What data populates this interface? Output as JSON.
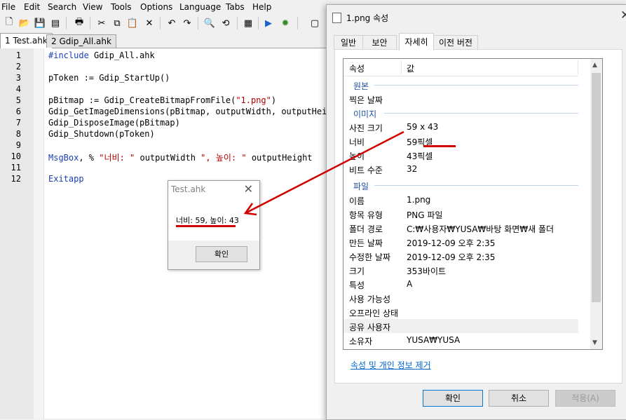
{
  "editor": {
    "menu": [
      "File",
      "Edit",
      "Search",
      "View",
      "Tools",
      "Options",
      "Language",
      "Tabs",
      "Help"
    ],
    "tabs": [
      "1 Test.ahk",
      "2 Gdip_All.ahk"
    ],
    "line_numbers": [
      "1",
      "2",
      "3",
      "4",
      "5",
      "6",
      "7",
      "8",
      "9",
      "10",
      "11",
      "12"
    ],
    "lines": {
      "l1_kw": "#include",
      "l1_rest": " Gdip_All.ahk",
      "l3": "pToken := Gdip_StartUp()",
      "l5_a": "pBitmap := Gdip_CreateBitmapFromFile(",
      "l5_str": "\"1.png\"",
      "l5_b": ")",
      "l6": "Gdip_GetImageDimensions(pBitmap, outputWidth, outputHeight)",
      "l7": "Gdip_DisposeImage(pBitmap)",
      "l8": "Gdip_Shutdown(pToken)",
      "l10_kw": "MsgBox",
      "l10_a": ", % ",
      "l10_str1": "\"너비: \"",
      "l10_b": " outputWidth ",
      "l10_str2": "\", 높이: \"",
      "l10_c": " outputHeight",
      "l12_kw": "Exitapp"
    }
  },
  "msgbox": {
    "title": "Test.ahk",
    "text": "너비: 59, 높이: 43",
    "ok_label": "확인"
  },
  "properties": {
    "title": "1.png 속성",
    "tabs": [
      "일반",
      "보안",
      "자세히",
      "이전 버전"
    ],
    "active_tab": "자세히",
    "header": {
      "name": "속성",
      "value": "값"
    },
    "groups": {
      "origin": "원본",
      "image": "이미지",
      "file": "파일"
    },
    "rows": [
      {
        "name": "찍은 날짜",
        "value": ""
      },
      {
        "name": "사진 크기",
        "value": "59 x 43"
      },
      {
        "name": "너비",
        "value": "59픽셀"
      },
      {
        "name": "높이",
        "value": "43픽셀"
      },
      {
        "name": "비트 수준",
        "value": "32"
      },
      {
        "name": "이름",
        "value": "1.png"
      },
      {
        "name": "항목 유형",
        "value": "PNG 파일"
      },
      {
        "name": "폴더 경로",
        "value": "C:₩사용자₩YUSA₩바탕 화면₩새 폴더"
      },
      {
        "name": "만든 날짜",
        "value": "2019-12-09 오후 2:35"
      },
      {
        "name": "수정한 날짜",
        "value": "2019-12-09 오후 2:35"
      },
      {
        "name": "크기",
        "value": "353바이트"
      },
      {
        "name": "특성",
        "value": "A"
      },
      {
        "name": "사용 가능성",
        "value": ""
      },
      {
        "name": "오프라인 상태",
        "value": ""
      },
      {
        "name": "공유 사용자",
        "value": ""
      },
      {
        "name": "소유자",
        "value": "YUSA₩YUSA"
      }
    ],
    "remove_link": "속성 및 개인 정보 제거",
    "buttons": {
      "ok": "확인",
      "cancel": "취소",
      "apply": "적용(A)"
    }
  },
  "colors": {
    "annotation": "#d00000",
    "link": "#0066cc",
    "group_label": "#1e4fa0"
  }
}
